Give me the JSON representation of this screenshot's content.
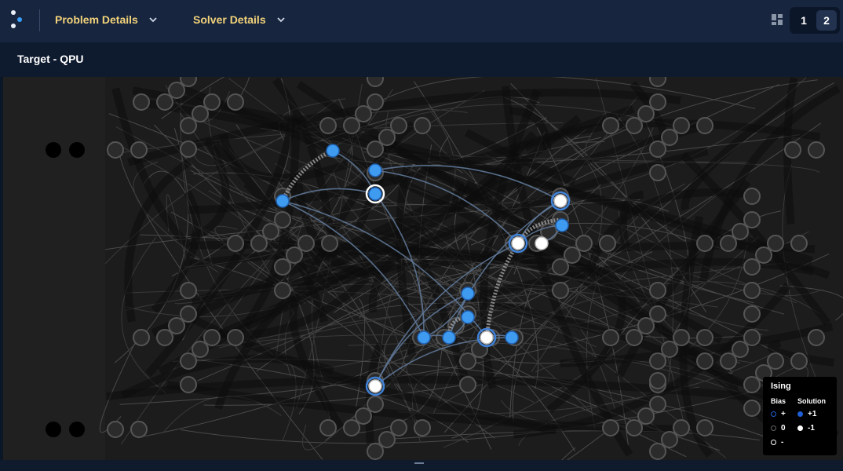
{
  "header": {
    "menus": [
      {
        "label": "Problem Details"
      },
      {
        "label": "Solver Details"
      }
    ],
    "pages": [
      "1",
      "2"
    ],
    "active_page": "2"
  },
  "panel": {
    "title": "Target - QPU"
  },
  "legend": {
    "title": "Ising",
    "bias_header": "Bias",
    "solution_header": "Solution",
    "bias_items": [
      {
        "symbol": "+",
        "color": "#1f5fd6"
      },
      {
        "symbol": "0",
        "color": "#666666"
      },
      {
        "symbol": "-",
        "color": "#ffffff"
      }
    ],
    "solution_items": [
      {
        "symbol": "+1",
        "color": "#1f5fd6"
      },
      {
        "symbol": "-1",
        "color": "#ffffff"
      }
    ]
  },
  "colors": {
    "accent": "#f3d37a",
    "node_plus": "#3f9bf0",
    "node_minus": "#ffffff",
    "node_idle": "#2b2b2b"
  }
}
